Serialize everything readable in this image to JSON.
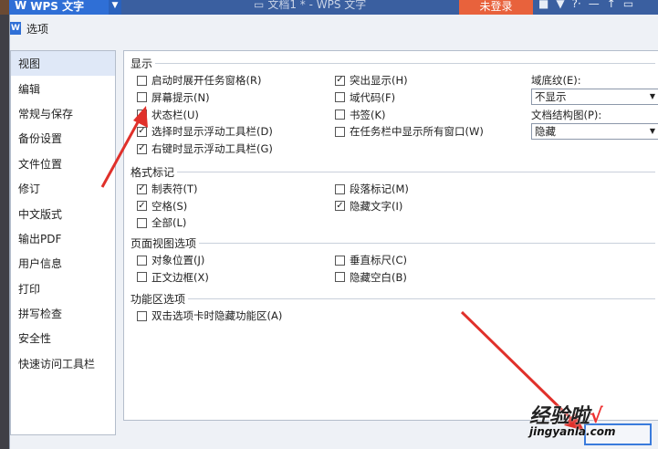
{
  "titlebar": {
    "app_name": "WPS 文字",
    "doc_title": "文档1 * - WPS 文字",
    "login": "未登录"
  },
  "dialog": {
    "title": "选项",
    "nav": [
      {
        "label": "视图",
        "selected": true
      },
      {
        "label": "编辑"
      },
      {
        "label": "常规与保存"
      },
      {
        "label": "备份设置"
      },
      {
        "label": "文件位置"
      },
      {
        "label": "修订"
      },
      {
        "label": "中文版式"
      },
      {
        "label": "输出PDF"
      },
      {
        "label": "用户信息"
      },
      {
        "label": "打印"
      },
      {
        "label": "拼写检查"
      },
      {
        "label": "安全性"
      },
      {
        "label": "快速访问工具栏"
      }
    ]
  },
  "display": {
    "title": "显示",
    "col1": [
      {
        "label": "启动时展开任务窗格(R)",
        "checked": false
      },
      {
        "label": "屏幕提示(N)",
        "checked": false
      },
      {
        "label": "状态栏(U)",
        "checked": true
      },
      {
        "label": "选择时显示浮动工具栏(D)",
        "checked": true
      },
      {
        "label": "右键时显示浮动工具栏(G)",
        "checked": true
      }
    ],
    "col2": [
      {
        "label": "突出显示(H)",
        "checked": true
      },
      {
        "label": "域代码(F)",
        "checked": false
      },
      {
        "label": "书签(K)",
        "checked": false
      },
      {
        "label": "在任务栏中显示所有窗口(W)",
        "checked": false
      }
    ],
    "field_shading_label": "域底纹(E):",
    "field_shading_value": "不显示",
    "doc_map_label": "文档结构图(P):",
    "doc_map_value": "隐藏"
  },
  "format_marks": {
    "title": "格式标记",
    "col1": [
      {
        "label": "制表符(T)",
        "checked": true
      },
      {
        "label": "空格(S)",
        "checked": true
      },
      {
        "label": "全部(L)",
        "checked": false
      }
    ],
    "col2": [
      {
        "label": "段落标记(M)",
        "checked": false
      },
      {
        "label": "隐藏文字(I)",
        "checked": true
      }
    ]
  },
  "page_view": {
    "title": "页面视图选项",
    "col1": [
      {
        "label": "对象位置(J)",
        "checked": false
      },
      {
        "label": "正文边框(X)",
        "checked": false
      }
    ],
    "col2": [
      {
        "label": "垂直标尺(C)",
        "checked": false
      },
      {
        "label": "隐藏空白(B)",
        "checked": false
      }
    ]
  },
  "ribbon": {
    "title": "功能区选项",
    "col1": [
      {
        "label": "双击选项卡时隐藏功能区(A)",
        "checked": false
      }
    ]
  },
  "watermark": {
    "text": "经验啦",
    "check": "√",
    "url": "jingyanla.com"
  },
  "colors": {
    "accent": "#2f6fd6",
    "login": "#e8623c",
    "arrow": "#e0302a"
  }
}
